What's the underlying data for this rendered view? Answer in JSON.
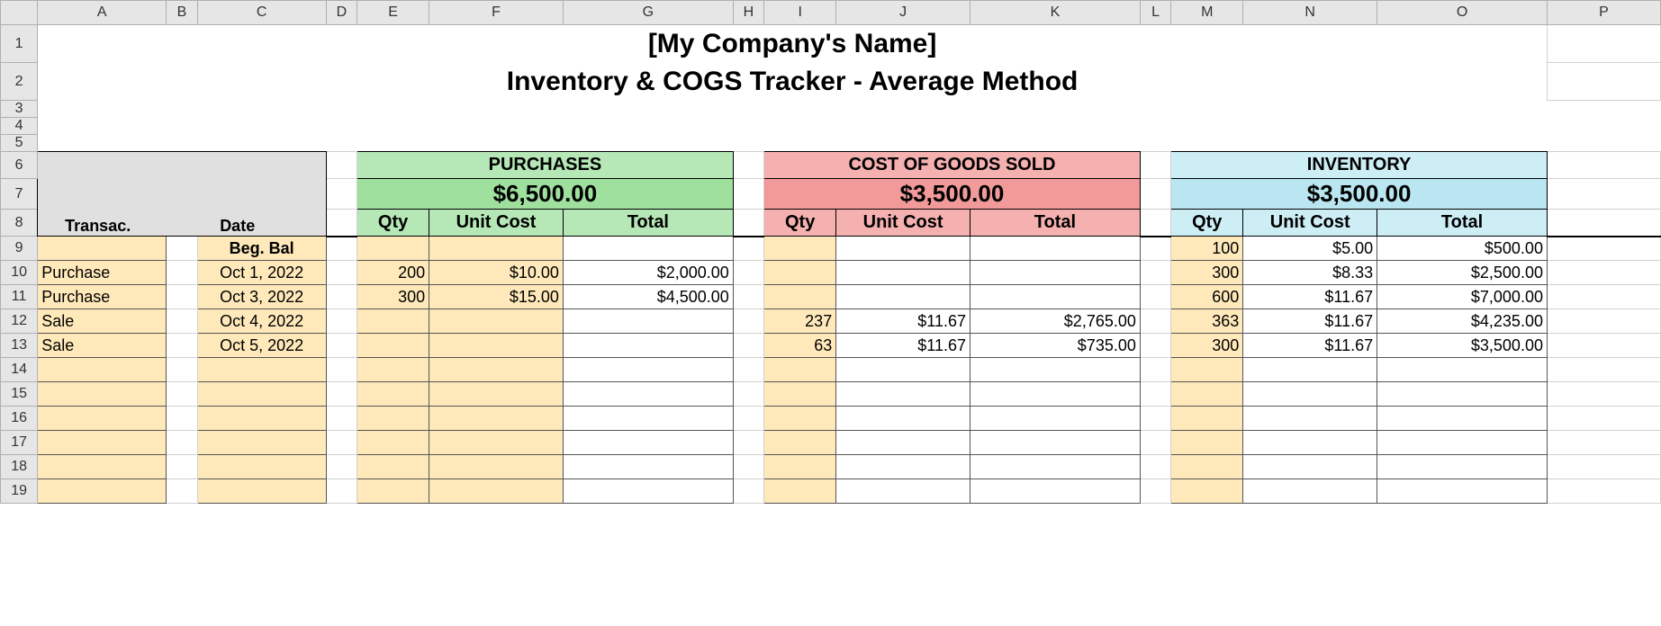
{
  "columns": [
    "",
    "A",
    "B",
    "C",
    "D",
    "E",
    "F",
    "G",
    "H",
    "I",
    "J",
    "K",
    "L",
    "M",
    "N",
    "O",
    "P"
  ],
  "title1": "[My Company's Name]",
  "title2": "Inventory & COGS Tracker - Average Method",
  "labels": {
    "transac": "Transac.",
    "date": "Date",
    "qty": "Qty",
    "unitcost": "Unit Cost",
    "total": "Total",
    "begbal": "Beg. Bal"
  },
  "groups": {
    "purchases": {
      "name": "PURCHASES",
      "sum": "$6,500.00"
    },
    "cogs": {
      "name": "COST OF GOODS SOLD",
      "sum": "$3,500.00"
    },
    "inventory": {
      "name": "INVENTORY",
      "sum": "$3,500.00"
    }
  },
  "rows": [
    {
      "n": "9",
      "transac": "",
      "date": "Beg. Bal",
      "p_qty": "",
      "p_uc": "",
      "p_tot": "",
      "c_qty": "",
      "c_uc": "",
      "c_tot": "",
      "i_qty": "100",
      "i_uc": "$5.00",
      "i_tot": "$500.00"
    },
    {
      "n": "10",
      "transac": "Purchase",
      "date": "Oct 1, 2022",
      "p_qty": "200",
      "p_uc": "$10.00",
      "p_tot": "$2,000.00",
      "c_qty": "",
      "c_uc": "",
      "c_tot": "",
      "i_qty": "300",
      "i_uc": "$8.33",
      "i_tot": "$2,500.00"
    },
    {
      "n": "11",
      "transac": "Purchase",
      "date": "Oct 3, 2022",
      "p_qty": "300",
      "p_uc": "$15.00",
      "p_tot": "$4,500.00",
      "c_qty": "",
      "c_uc": "",
      "c_tot": "",
      "i_qty": "600",
      "i_uc": "$11.67",
      "i_tot": "$7,000.00"
    },
    {
      "n": "12",
      "transac": "Sale",
      "date": "Oct 4, 2022",
      "p_qty": "",
      "p_uc": "",
      "p_tot": "",
      "c_qty": "237",
      "c_uc": "$11.67",
      "c_tot": "$2,765.00",
      "i_qty": "363",
      "i_uc": "$11.67",
      "i_tot": "$4,235.00"
    },
    {
      "n": "13",
      "transac": "Sale",
      "date": "Oct 5, 2022",
      "p_qty": "",
      "p_uc": "",
      "p_tot": "",
      "c_qty": "63",
      "c_uc": "$11.67",
      "c_tot": "$735.00",
      "i_qty": "300",
      "i_uc": "$11.67",
      "i_tot": "$3,500.00"
    },
    {
      "n": "14"
    },
    {
      "n": "15"
    },
    {
      "n": "16"
    },
    {
      "n": "17"
    },
    {
      "n": "18"
    },
    {
      "n": "19"
    }
  ],
  "chart_data": {
    "type": "table",
    "title": "Inventory & COGS Tracker - Average Method",
    "summary": {
      "purchases_total": 6500.0,
      "cogs_total": 3500.0,
      "inventory_total": 3500.0
    },
    "transactions": [
      {
        "type": "Beginning Balance",
        "date": null,
        "purchase": null,
        "cogs": null,
        "inventory": {
          "qty": 100,
          "unit_cost": 5.0,
          "total": 500.0
        }
      },
      {
        "type": "Purchase",
        "date": "2022-10-01",
        "purchase": {
          "qty": 200,
          "unit_cost": 10.0,
          "total": 2000.0
        },
        "cogs": null,
        "inventory": {
          "qty": 300,
          "unit_cost": 8.33,
          "total": 2500.0
        }
      },
      {
        "type": "Purchase",
        "date": "2022-10-03",
        "purchase": {
          "qty": 300,
          "unit_cost": 15.0,
          "total": 4500.0
        },
        "cogs": null,
        "inventory": {
          "qty": 600,
          "unit_cost": 11.67,
          "total": 7000.0
        }
      },
      {
        "type": "Sale",
        "date": "2022-10-04",
        "purchase": null,
        "cogs": {
          "qty": 237,
          "unit_cost": 11.67,
          "total": 2765.0
        },
        "inventory": {
          "qty": 363,
          "unit_cost": 11.67,
          "total": 4235.0
        }
      },
      {
        "type": "Sale",
        "date": "2022-10-05",
        "purchase": null,
        "cogs": {
          "qty": 63,
          "unit_cost": 11.67,
          "total": 735.0
        },
        "inventory": {
          "qty": 300,
          "unit_cost": 11.67,
          "total": 3500.0
        }
      }
    ]
  }
}
